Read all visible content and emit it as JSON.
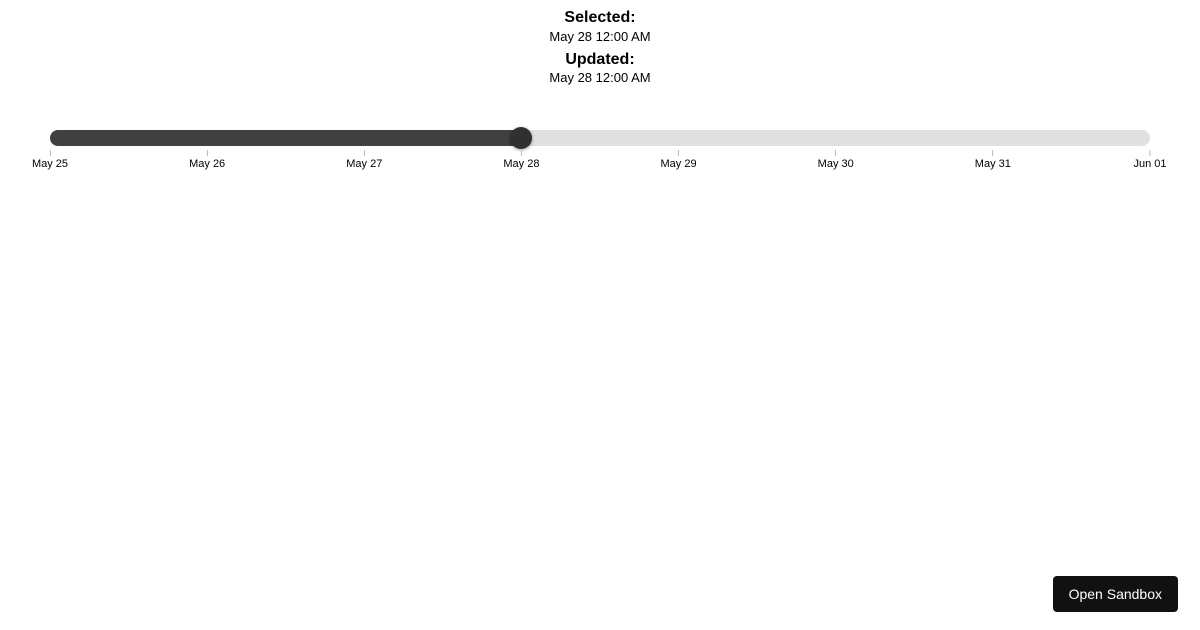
{
  "header": {
    "selected_label": "Selected:",
    "selected_value": "May 28 12:00 AM",
    "updated_label": "Updated:",
    "updated_value": "May 28 12:00 AM"
  },
  "slider": {
    "min": 0,
    "max": 7,
    "value": 3,
    "ticks": [
      {
        "label": "May 25",
        "position": 0
      },
      {
        "label": "May 26",
        "position": 1
      },
      {
        "label": "May 27",
        "position": 2
      },
      {
        "label": "May 28",
        "position": 3
      },
      {
        "label": "May 29",
        "position": 4
      },
      {
        "label": "May 30",
        "position": 5
      },
      {
        "label": "May 31",
        "position": 6
      },
      {
        "label": "Jun 01",
        "position": 7
      }
    ]
  },
  "sandbox_button": "Open Sandbox"
}
